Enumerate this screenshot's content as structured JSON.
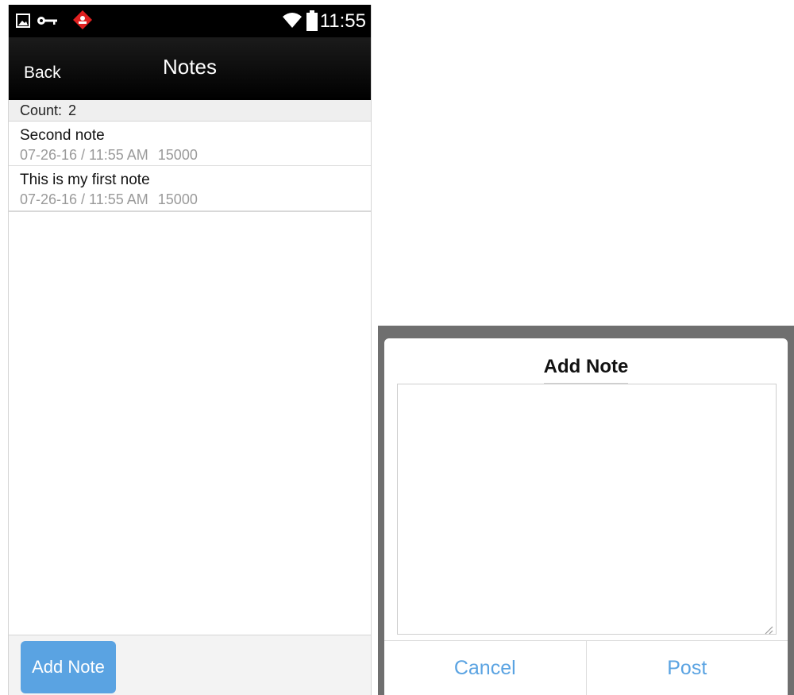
{
  "status_bar": {
    "time": "11:55",
    "icons": [
      "image-icon",
      "key-icon",
      "alert-icon",
      "wifi-icon",
      "battery-icon"
    ],
    "alert_color": "#e02020"
  },
  "header": {
    "back_label": "Back",
    "title": "Notes"
  },
  "count": {
    "label": "Count:",
    "value": "2"
  },
  "notes": [
    {
      "title": "Second note",
      "date": "07-26-16 / 11:55 AM",
      "id": "15000"
    },
    {
      "title": "This is my first note",
      "date": "07-26-16 / 11:55 AM",
      "id": "15000"
    }
  ],
  "footer": {
    "add_note_label": "Add Note"
  },
  "dialog": {
    "title": "Add Note",
    "textarea_value": "",
    "cancel_label": "Cancel",
    "post_label": "Post"
  },
  "colors": {
    "accent": "#5aa3e2",
    "header_bg": "#000000"
  }
}
